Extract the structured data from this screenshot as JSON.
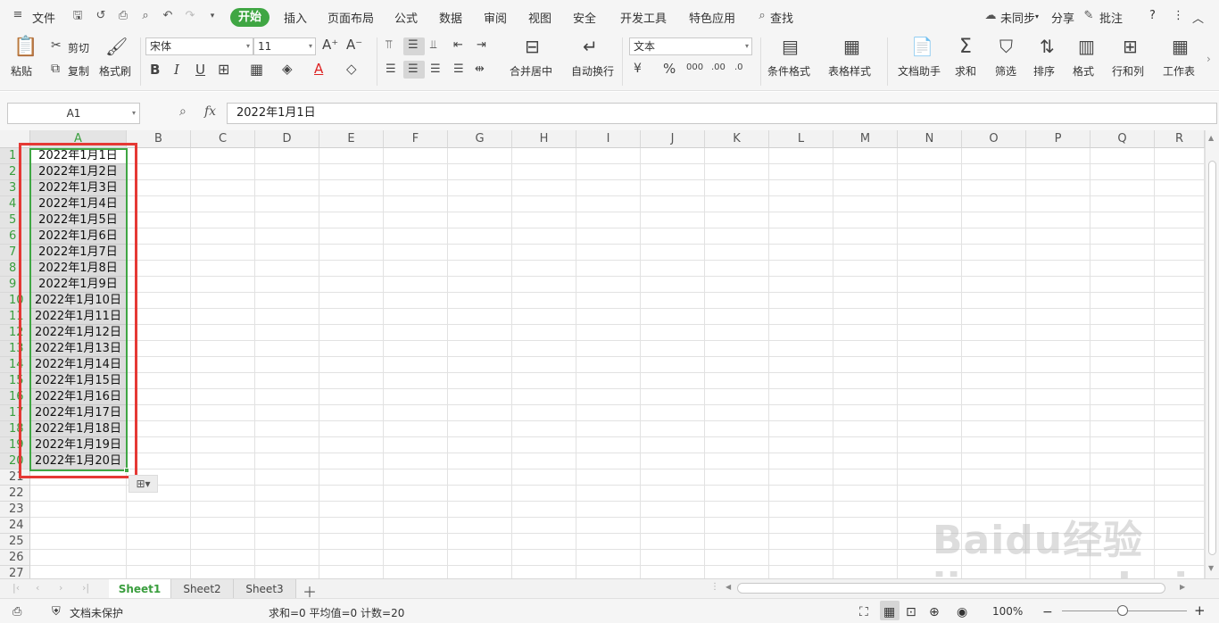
{
  "menu": {
    "file": "文件",
    "tabs": [
      "开始",
      "插入",
      "页面布局",
      "公式",
      "数据",
      "审阅",
      "视图",
      "安全",
      "开发工具",
      "特色应用"
    ],
    "search": "查找",
    "sync": "未同步",
    "share": "分享",
    "comment": "批注",
    "help": "?"
  },
  "ribbon": {
    "paste": "粘贴",
    "cut": "剪切",
    "copy": "复制",
    "format_painter": "格式刷",
    "font_name": "宋体",
    "font_size": "11",
    "merge_center": "合并居中",
    "wrap_text": "自动换行",
    "number_format": "文本",
    "conditional_format": "条件格式",
    "table_style": "表格样式",
    "doc_assistant": "文档助手",
    "sum": "求和",
    "filter": "筛选",
    "sort": "排序",
    "format": "格式",
    "row_col": "行和列",
    "worksheet": "工作表"
  },
  "formula_bar": {
    "name_box": "A1",
    "fx": "fx",
    "content": "2022年1月1日"
  },
  "columns": [
    "A",
    "B",
    "C",
    "D",
    "E",
    "F",
    "G",
    "H",
    "I",
    "J",
    "K",
    "L",
    "M",
    "N",
    "O",
    "P",
    "Q",
    "R"
  ],
  "rows": [
    "1",
    "2",
    "3",
    "4",
    "5",
    "6",
    "7",
    "8",
    "9",
    "10",
    "11",
    "12",
    "13",
    "14",
    "15",
    "16",
    "17",
    "18",
    "19",
    "20",
    "21",
    "22",
    "23",
    "24",
    "25",
    "26",
    "27"
  ],
  "cells_A": [
    "2022年1月1日",
    "2022年1月2日",
    "2022年1月3日",
    "2022年1月4日",
    "2022年1月5日",
    "2022年1月6日",
    "2022年1月7日",
    "2022年1月8日",
    "2022年1月9日",
    "2022年1月10日",
    "2022年1月11日",
    "2022年1月12日",
    "2022年1月13日",
    "2022年1月14日",
    "2022年1月15日",
    "2022年1月16日",
    "2022年1月17日",
    "2022年1月18日",
    "2022年1月19日",
    "2022年1月20日"
  ],
  "sheets": [
    "Sheet1",
    "Sheet2",
    "Sheet3"
  ],
  "status": {
    "protect": "文档未保护",
    "summary": "求和=0  平均值=0  计数=20",
    "zoom": "100%"
  },
  "colors": {
    "accent": "#3fa643",
    "annotation": "#e53935"
  },
  "watermark": "Baidu经验 jingyan.baidu.com"
}
